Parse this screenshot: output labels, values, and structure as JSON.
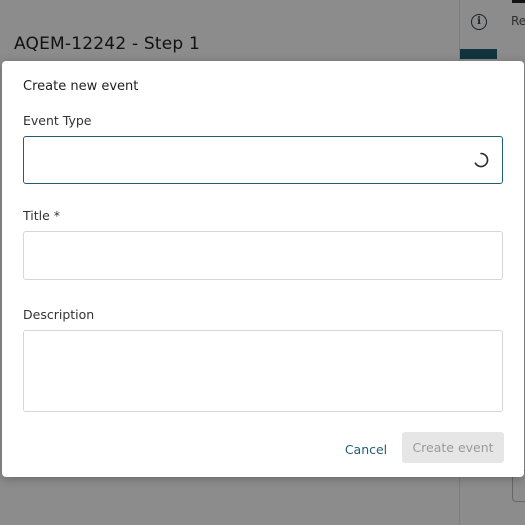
{
  "background": {
    "page_title": "AQEM-12242 - Step 1",
    "side_text": "Re"
  },
  "modal": {
    "title": "Create new event",
    "fields": {
      "event_type": {
        "label": "Event Type",
        "value": ""
      },
      "title": {
        "label": "Title *",
        "value": ""
      },
      "description": {
        "label": "Description",
        "value": ""
      }
    },
    "buttons": {
      "cancel": "Cancel",
      "create": "Create event"
    }
  },
  "colors": {
    "accent": "#1f5f74",
    "disabled_bg": "#e6e6e6",
    "disabled_text": "#9a9a9a"
  }
}
